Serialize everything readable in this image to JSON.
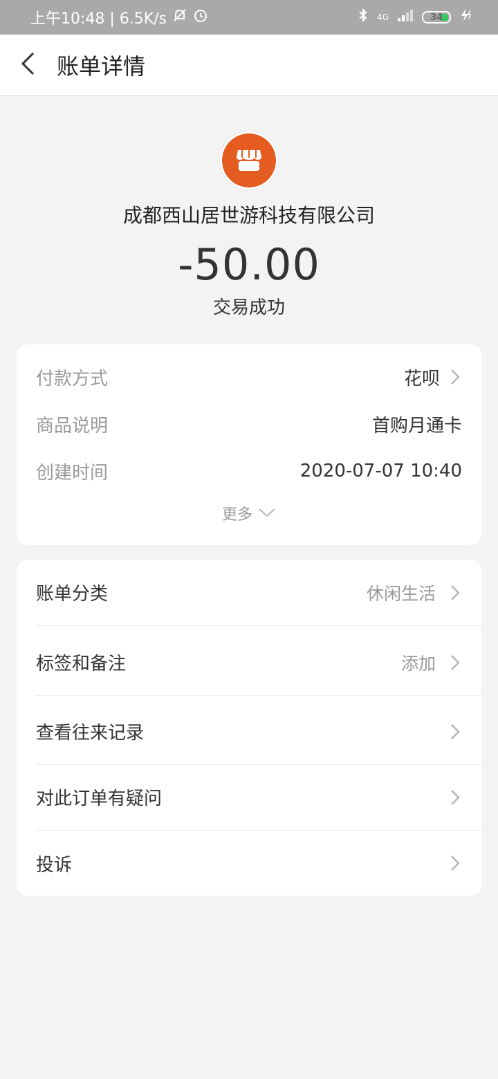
{
  "status_bar": {
    "time_speed": "上午10:48 | 6.5K/s",
    "network": "4G",
    "battery": "34"
  },
  "header": {
    "title": "账单详情"
  },
  "summary": {
    "merchant": "成都西山居世游科技有限公司",
    "amount": "-50.00",
    "status": "交易成功"
  },
  "details": {
    "rows": [
      {
        "label": "付款方式",
        "value": "花呗"
      },
      {
        "label": "商品说明",
        "value": "首购月通卡"
      },
      {
        "label": "创建时间",
        "value": "2020-07-07 10:40"
      }
    ],
    "more": "更多"
  },
  "menu": {
    "items": [
      {
        "label": "账单分类",
        "value": "休闲生活"
      },
      {
        "label": "标签和备注",
        "value": "添加"
      },
      {
        "label": "查看往来记录",
        "value": ""
      },
      {
        "label": "对此订单有疑问",
        "value": ""
      },
      {
        "label": "投诉",
        "value": ""
      }
    ]
  },
  "colors": {
    "accent": "#e45c1f",
    "background": "#f3f3f3",
    "status_bar": "#a9a9a9"
  }
}
